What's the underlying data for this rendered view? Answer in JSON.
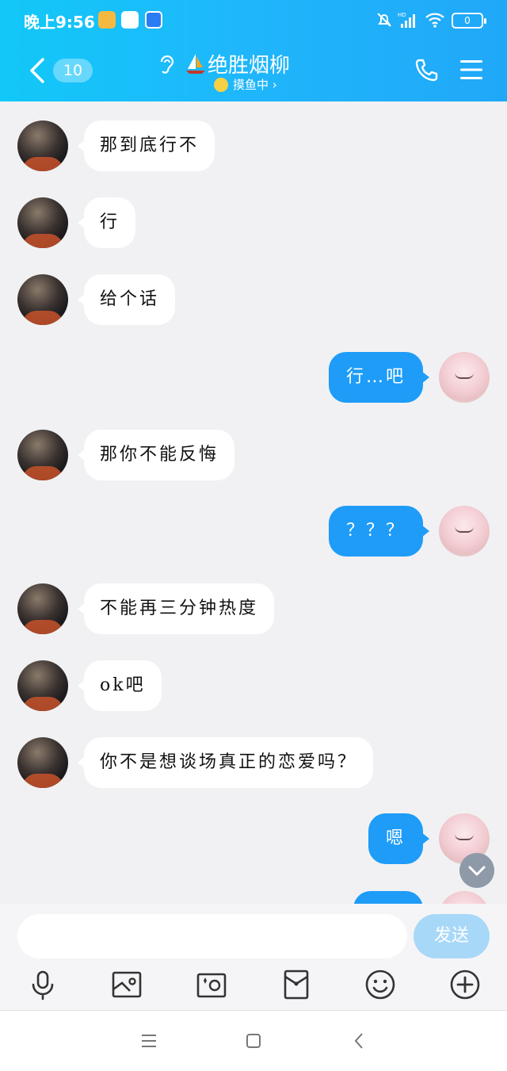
{
  "status": {
    "time": "晚上9:56",
    "battery": "0",
    "network": "HD"
  },
  "header": {
    "unread_count": "10",
    "contact_name": "绝胜烟柳",
    "contact_status": "摸鱼中 ›",
    "colors": {
      "header_start": "#12c8f8",
      "header_end": "#20a8f8"
    }
  },
  "messages": [
    {
      "side": "left",
      "text": "那到底行不"
    },
    {
      "side": "left",
      "text": "行"
    },
    {
      "side": "left",
      "text": "给个话"
    },
    {
      "side": "right",
      "text": "行…吧"
    },
    {
      "side": "left",
      "text": "那你不能反悔"
    },
    {
      "side": "right",
      "text": "？？？"
    },
    {
      "side": "left",
      "text": "不能再三分钟热度"
    },
    {
      "side": "left",
      "text": "ok吧"
    },
    {
      "side": "left",
      "text": "你不是想谈场真正的恋爱吗？"
    },
    {
      "side": "right",
      "text": "嗯"
    },
    {
      "side": "right",
      "text": ""
    }
  ],
  "composer": {
    "input_value": "",
    "send_label": "发送"
  },
  "toolbar_icons": [
    "microphone-icon",
    "image-icon",
    "camera-icon",
    "red-packet-icon",
    "emoji-icon",
    "plus-icon"
  ],
  "bubble_colors": {
    "left": "#ffffff",
    "right": "#1e9cf8"
  }
}
